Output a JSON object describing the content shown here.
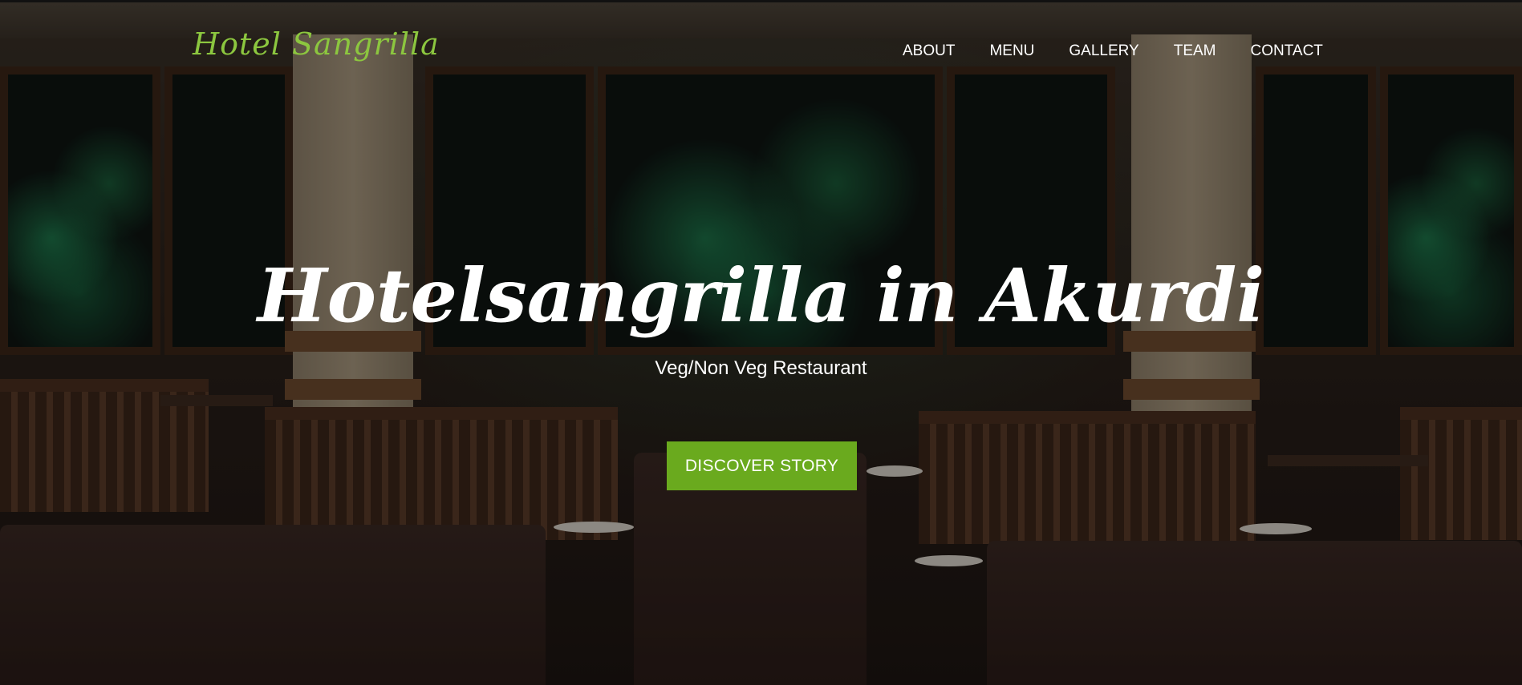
{
  "brand": {
    "logo_text": "Hotel Sangrilla",
    "accent_color": "#8cc63f"
  },
  "nav": {
    "items": [
      {
        "label": "ABOUT"
      },
      {
        "label": "MENU"
      },
      {
        "label": "GALLERY"
      },
      {
        "label": "TEAM"
      },
      {
        "label": "CONTACT"
      }
    ]
  },
  "hero": {
    "title": "Hotelsangrilla in Akurdi",
    "subtitle": "Veg/Non Veg Restaurant",
    "cta_label": "DISCOVER STORY",
    "cta_color": "#6aaa1e",
    "background": "restaurant-interior-photo"
  }
}
